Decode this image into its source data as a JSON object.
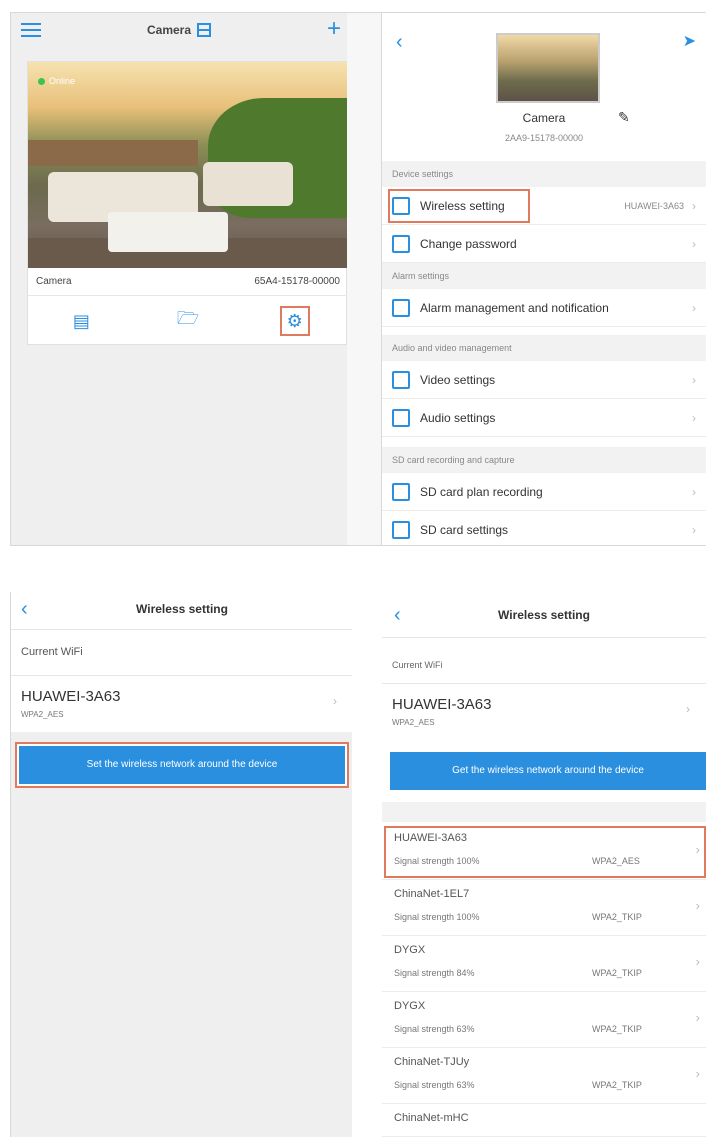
{
  "colors": {
    "accent": "#2b8fe0",
    "highlight": "#e07a5f",
    "online": "#3ac34e"
  },
  "home": {
    "title": "Camera",
    "online_status": "Online",
    "camera_name": "Camera",
    "camera_id": "65A4-15178-00000",
    "icons": [
      "menu-icon",
      "grid-icon",
      "plus-icon",
      "playback-icon",
      "folder-icon",
      "settings-icon"
    ]
  },
  "settings": {
    "device_name": "Camera",
    "device_id": "2AA9-15178-00000",
    "sections": [
      {
        "header": "Device settings"
      },
      {
        "header": "Alarm settings"
      },
      {
        "header": "Audio and video management"
      },
      {
        "header": "SD card recording and capture"
      }
    ],
    "rows": {
      "wireless": "Wireless setting",
      "wireless_value": "HUAWEI-3A63",
      "password": "Change password",
      "alarm": "Alarm management and notification",
      "video": "Video settings",
      "audio": "Audio settings",
      "sd_plan": "SD card plan recording",
      "sd_settings": "SD card settings"
    }
  },
  "wireless1": {
    "title": "Wireless setting",
    "current_label": "Current WiFi",
    "current_ssid": "HUAWEI-3A63",
    "current_security": "WPA2_AES",
    "button": "Set the wireless network around the device"
  },
  "wireless2": {
    "title": "Wireless setting",
    "current_label": "Current WiFi",
    "current_ssid": "HUAWEI-3A63",
    "current_security": "WPA2_AES",
    "button": "Get the wireless network around the device",
    "networks": [
      {
        "ssid": "HUAWEI-3A63",
        "signal": "Signal strength 100%",
        "security": "WPA2_AES"
      },
      {
        "ssid": "ChinaNet-1EL7",
        "signal": "Signal strength 100%",
        "security": "WPA2_TKIP"
      },
      {
        "ssid": "DYGX",
        "signal": "Signal strength 84%",
        "security": "WPA2_TKIP"
      },
      {
        "ssid": "DYGX",
        "signal": "Signal strength 63%",
        "security": "WPA2_TKIP"
      },
      {
        "ssid": "ChinaNet-TJUy",
        "signal": "Signal strength 63%",
        "security": "WPA2_TKIP"
      },
      {
        "ssid": "ChinaNet-mHC",
        "signal": "",
        "security": ""
      }
    ]
  }
}
